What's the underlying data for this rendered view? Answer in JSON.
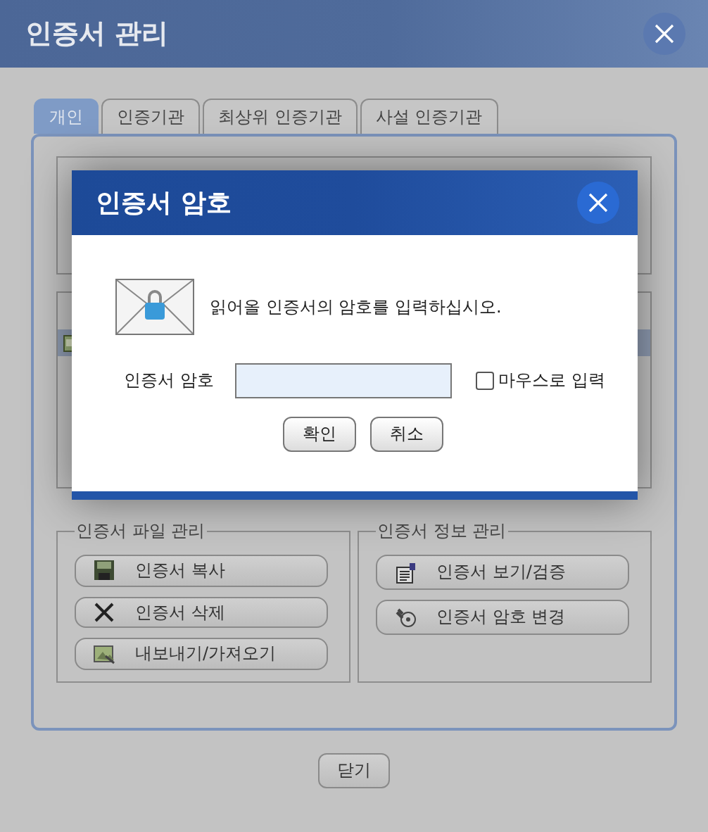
{
  "window": {
    "title": "인증서 관리"
  },
  "tabs": [
    {
      "label": "개인",
      "selected": true
    },
    {
      "label": "인증기관",
      "selected": false
    },
    {
      "label": "최상위 인증기관",
      "selected": false
    },
    {
      "label": "사설 인증기관",
      "selected": false
    }
  ],
  "certificate_list": {
    "rows": [
      {
        "selected": true
      }
    ]
  },
  "file_group": {
    "legend": "인증서 파일 관리",
    "buttons": [
      {
        "label": "인증서 복사",
        "kind": "save"
      },
      {
        "label": "인증서 삭제",
        "kind": "delete"
      },
      {
        "label": "내보내기/가져오기",
        "kind": "export"
      }
    ]
  },
  "info_group": {
    "legend": "인증서 정보 관리",
    "buttons": [
      {
        "label": "인증서 보기/검증",
        "kind": "view"
      },
      {
        "label": "인증서 암호 변경",
        "kind": "password"
      }
    ]
  },
  "close_button": "닫기",
  "dialog": {
    "title": "인증서 암호",
    "message": "읽어올 인증서의 암호를 입력하십시오.",
    "password_label": "인증서 암호",
    "mouse_input": {
      "label": "마우스로 입력",
      "checked": false
    },
    "buttons": [
      "확인",
      "취소"
    ]
  }
}
